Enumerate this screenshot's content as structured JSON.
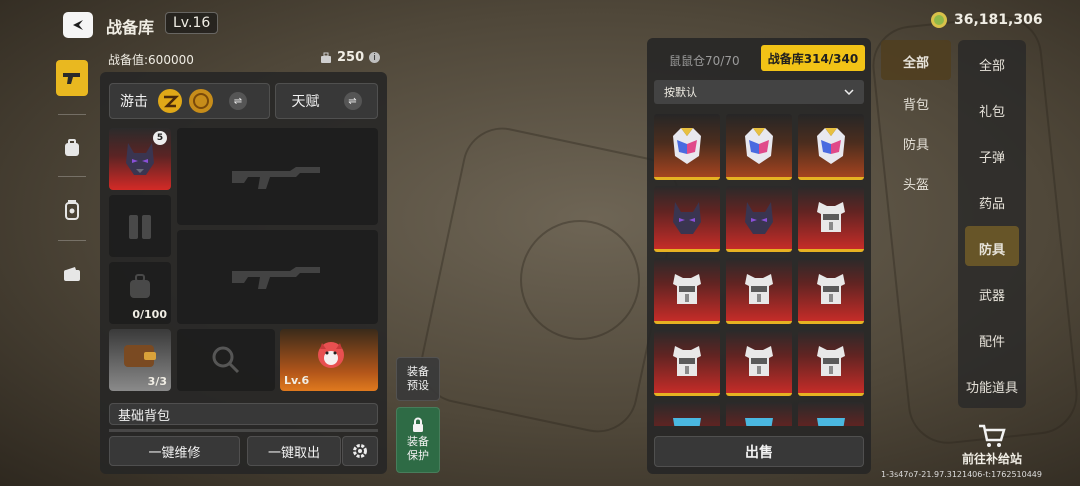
{
  "header": {
    "title": "战备库",
    "level": "Lv.16",
    "currency": "36,181,306"
  },
  "stats": {
    "power_label": "战备值:600000",
    "capacity": "250"
  },
  "loadout": {
    "mode_label": "游击",
    "talent_label": "天赋",
    "armor_count": "5",
    "bag_count": "0/100",
    "wallet_count": "3/3",
    "pet_level": "Lv.6",
    "bag_name": "基础背包",
    "repair_label": "一键维修",
    "takeout_label": "一键取出"
  },
  "preset": {
    "label1": "装备",
    "label2": "预设"
  },
  "protect": {
    "label1": "装备",
    "label2": "保护"
  },
  "storage": {
    "tab_hamster": "鼠鼠仓70/70",
    "tab_vault": "战备库314/340",
    "sort_label": "按默认",
    "sell_label": "出售"
  },
  "filter_mid": [
    "全部",
    "背包",
    "防具",
    "头盔"
  ],
  "filter_right": [
    "全部",
    "礼包",
    "子弹",
    "药品",
    "防具",
    "武器",
    "配件",
    "功能道具"
  ],
  "supply": {
    "label": "前往补给站"
  },
  "debug": "1-3s47o7-21.97.3121406-t:1762510449",
  "grid": [
    [
      "jester-helmet-icon",
      "jester-helmet-icon",
      "jester-helmet-icon"
    ],
    [
      "wolf-helmet-icon",
      "wolf-helmet-icon",
      "white-armor-icon"
    ],
    [
      "white-armor-icon",
      "white-armor-icon",
      "white-armor-icon"
    ],
    [
      "white-armor-icon",
      "white-armor-icon",
      "white-armor-icon"
    ],
    [
      "blue-armor-icon",
      "blue-armor-icon",
      "blue-armor-icon"
    ]
  ],
  "colors": {
    "accent": "#f2c316",
    "rarity_gold": "#e6b222",
    "rarity_red": "#c52c28",
    "protect_green": "#2e6b45"
  }
}
